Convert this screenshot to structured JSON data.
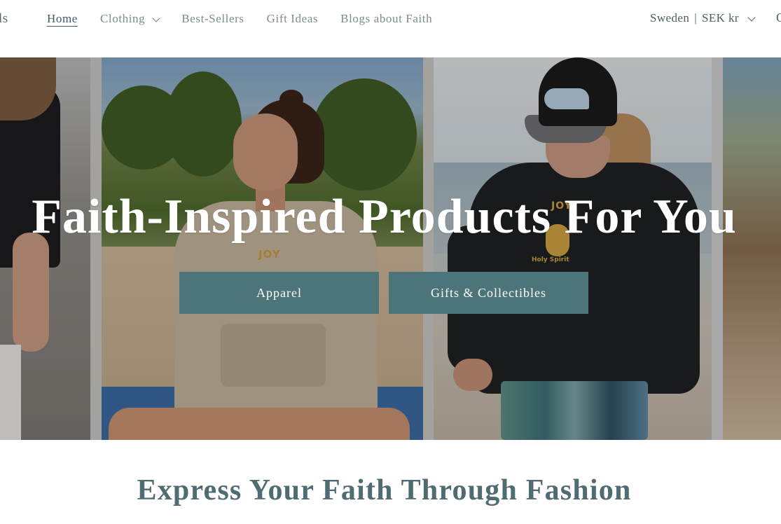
{
  "header": {
    "logo_fragment": "ls",
    "nav": [
      {
        "label": "Home",
        "active": true,
        "has_dropdown": false
      },
      {
        "label": "Clothing",
        "active": false,
        "has_dropdown": true
      },
      {
        "label": "Best-Sellers",
        "active": false,
        "has_dropdown": false
      },
      {
        "label": "Gift Ideas",
        "active": false,
        "has_dropdown": false
      },
      {
        "label": "Blogs about Faith",
        "active": false,
        "has_dropdown": false
      }
    ],
    "locale": {
      "country": "Sweden",
      "separator": "|",
      "currency": "SEK kr",
      "icon": "chevron-down-icon"
    },
    "edge_glyph": "C"
  },
  "hero": {
    "title": "Faith-Inspired Products For You",
    "buttons": [
      {
        "label": "Apparel"
      },
      {
        "label": "Gifts & Collectibles"
      }
    ],
    "image_text": {
      "joy_left": "JOY",
      "joy_right": "JOY",
      "holy_spirit": "Holy Spirit"
    }
  },
  "section": {
    "heading": "Express Your Faith Through Fashion"
  },
  "colors": {
    "button_bg": "#4c7479",
    "heading_text": "#4f6c72",
    "nav_text": "#7d8b90",
    "nav_active": "#3f5a60"
  }
}
